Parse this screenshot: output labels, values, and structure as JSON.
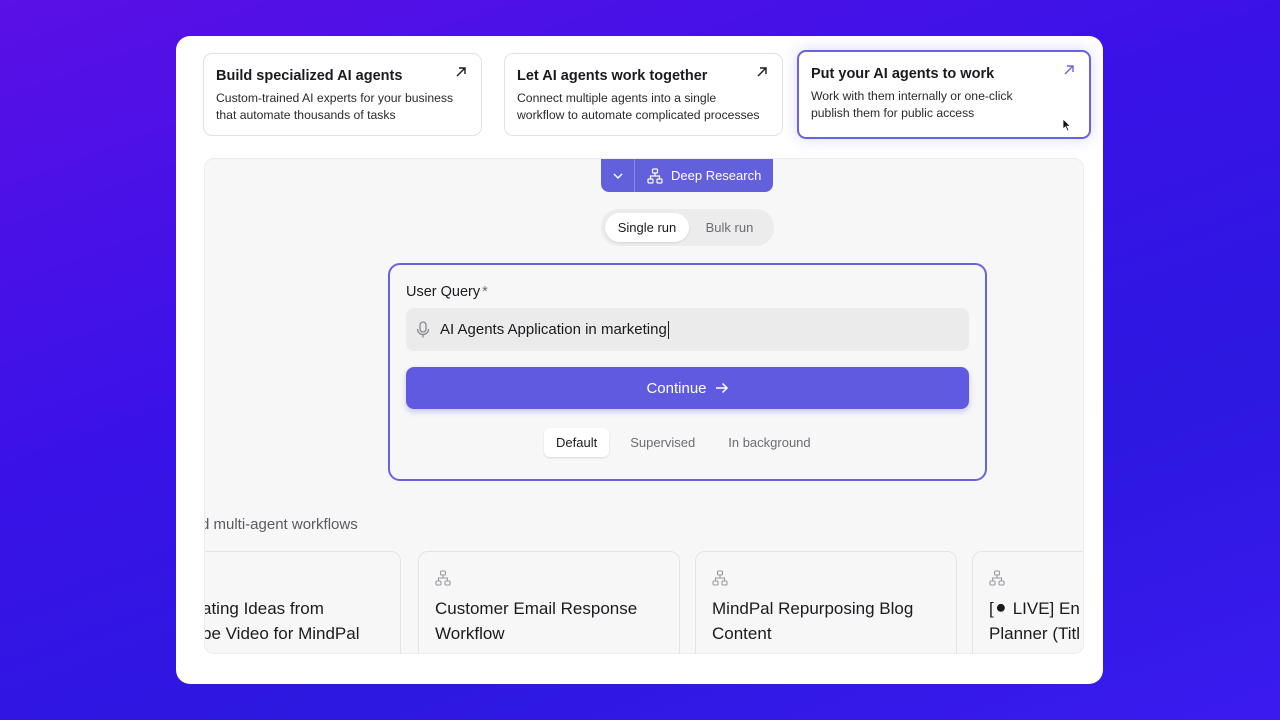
{
  "features": [
    {
      "title": "Build specialized AI agents",
      "desc_line1": "Custom-trained AI experts for your business",
      "desc_line2": "that automate thousands of tasks"
    },
    {
      "title": "Let AI agents work together",
      "desc_line1": "Connect multiple agents into a single",
      "desc_line2": "workflow to automate complicated processes"
    },
    {
      "title": "Put your AI agents to work",
      "desc_line1": "Work with them internally or one-click",
      "desc_line2": "publish them for public access"
    }
  ],
  "agent_selector": {
    "label": "Deep Research"
  },
  "run_toggle": {
    "single": "Single run",
    "bulk": "Bulk run"
  },
  "query": {
    "label": "User Query",
    "required_mark": "*",
    "value": "AI Agents Application in marketing"
  },
  "continue_label": "Continue",
  "modes": [
    "Default",
    "Supervised",
    "In background"
  ],
  "section_title": "d multi-agent workflows",
  "workflows": [
    {
      "line1": "ating Ideas from",
      "line2": "be Video for MindPal"
    },
    {
      "line1": "Customer Email Response",
      "line2": "Workflow"
    },
    {
      "line1": "MindPal Repurposing Blog",
      "line2": "Content"
    },
    {
      "line1": "[⚫ LIVE] En",
      "line2": "Planner (Titl"
    }
  ],
  "colors": {
    "accent": "#6360dc",
    "background": "#3a12e8"
  }
}
